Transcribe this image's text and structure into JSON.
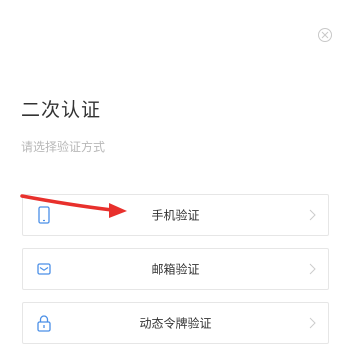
{
  "dialog": {
    "title": "二次认证",
    "subtitle": "请选择验证方式"
  },
  "options": [
    {
      "label": "手机验证",
      "icon": "mobile-phone-icon"
    },
    {
      "label": "邮箱验证",
      "icon": "mail-icon"
    },
    {
      "label": "动态令牌验证",
      "icon": "lock-icon"
    }
  ],
  "colors": {
    "accent_icon": "#4a8fe7",
    "annotation_arrow": "#e8302c",
    "border": "#e6e6e6",
    "title_text": "#333333",
    "subtitle_text": "#b8b8b8"
  }
}
